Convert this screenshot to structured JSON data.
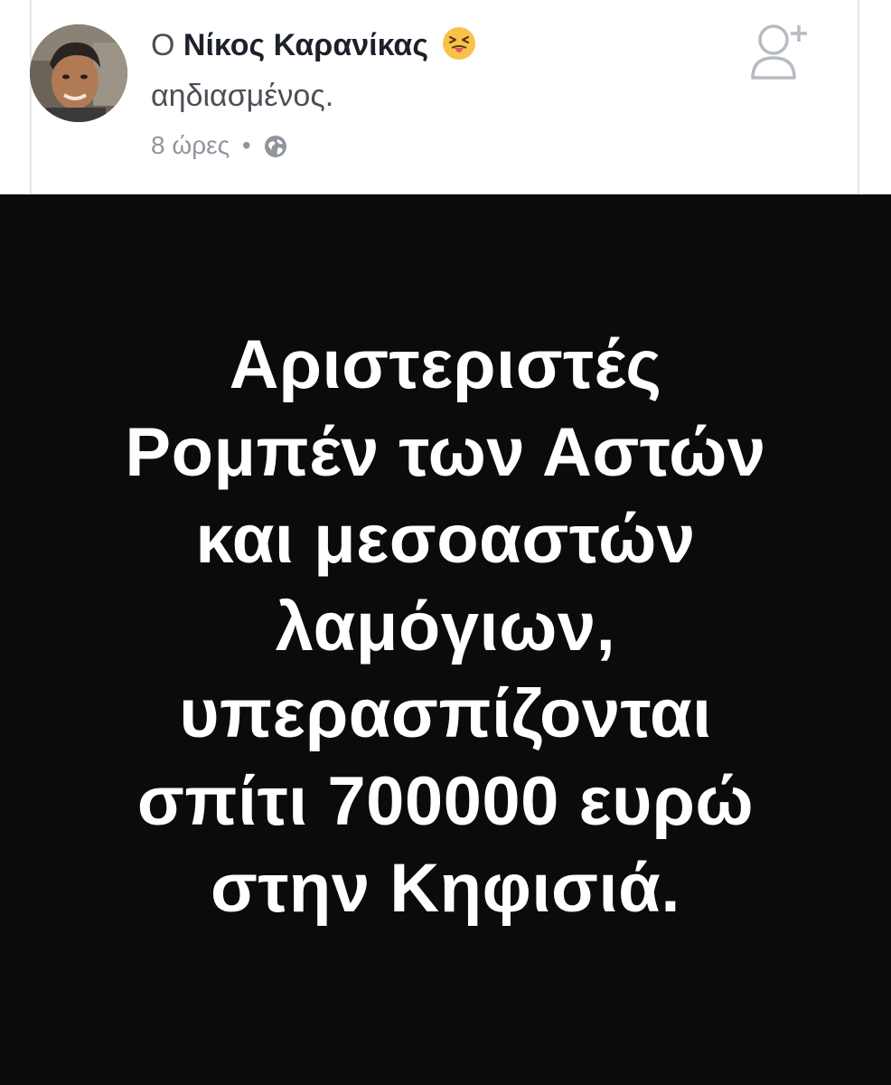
{
  "post": {
    "author_prefix": "Ο",
    "author_name": "Νίκος Καρανίκας",
    "feeling": "αηδιασμένος.",
    "timestamp": "8 ώρες",
    "separator": "•",
    "privacy_icon": "globe-icon",
    "feeling_icon": "disgusted-face-emoji",
    "add_friend_icon": "add-friend-icon"
  },
  "image": {
    "background_color": "#0b0b0b",
    "text_color": "#ffffff",
    "lines": [
      "Αριστεριστές",
      "Ρομπέν των Αστών",
      "και μεσοαστών",
      "λαμόγιων,",
      "υπερασπίζονται",
      "σπίτι 700000 ευρώ",
      "στην Κηφισιά."
    ]
  }
}
